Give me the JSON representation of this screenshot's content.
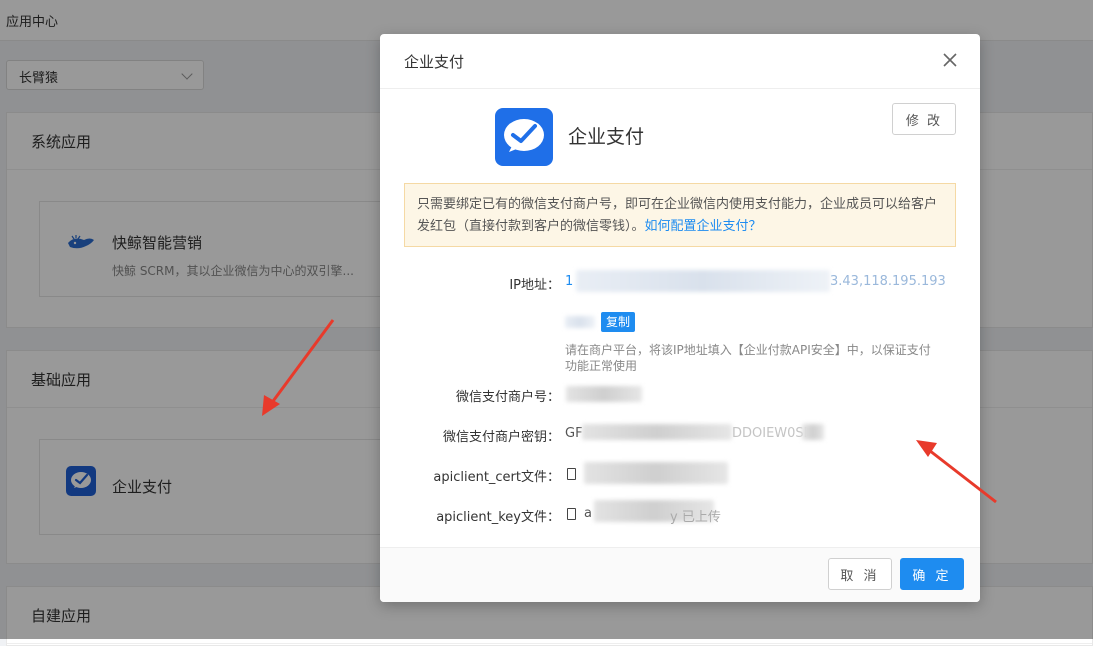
{
  "page": {
    "breadcrumb": "应用中心",
    "corp_select": "长臂猿",
    "sections": {
      "system": "系统应用",
      "basic": "基础应用",
      "custom": "自建应用"
    },
    "cards": {
      "kuaijing_name": "快鲸智能营销",
      "kuaijing_desc": "快鲸 SCRM，其以企业微信为中心的双引擎...",
      "pay_name": "企业支付"
    }
  },
  "modal": {
    "title": "企业支付",
    "app_title": "企业支付",
    "edit_label": "修 改",
    "notice_text": "只需要绑定已有的微信支付商户号，即可在企业微信内使用支付能力，企业成员可以给客户发红包（直接付款到客户的微信零钱）。",
    "notice_link": "如何配置企业支付？",
    "fields": {
      "ip_label": "IP地址：",
      "ip_value_start": "1",
      "ip_value_end": "3.43,118.195.193",
      "copy_label": "复制",
      "ip_hint": "请在商户平台，将该IP地址填入【企业付款API安全】中，以保证支付功能正常使用",
      "mch_label": "微信支付商户号：",
      "key_label": "微信支付商户密钥：",
      "key_value_start": "GF",
      "key_value_mid": "DDOIEW0SI",
      "cert_label": "apiclient_cert文件：",
      "keyfile_label": "apiclient_key文件：",
      "keyfile_value_start": "a",
      "keyfile_value_end": "y 已上传"
    },
    "cancel_label": "取 消",
    "ok_label": "确 定"
  },
  "colors": {
    "primary": "#1e8cf0",
    "notice_bg": "#fdf6e6",
    "annotation_arrow": "#e83a2b"
  }
}
